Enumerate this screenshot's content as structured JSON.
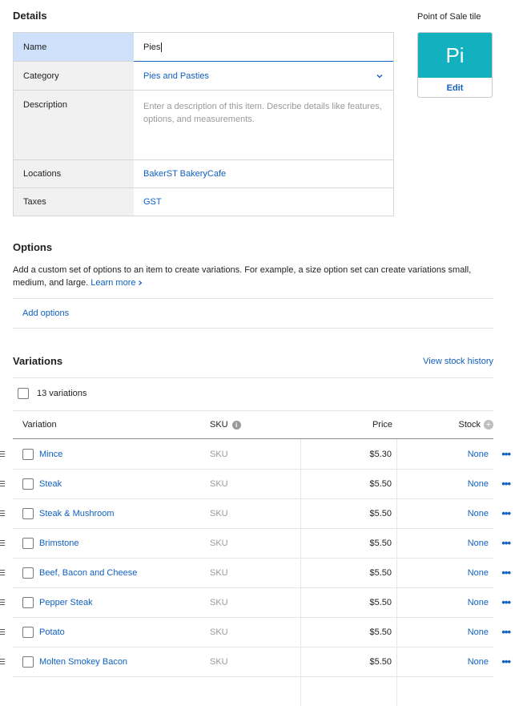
{
  "details": {
    "heading": "Details",
    "name_label": "Name",
    "name_value": "Pies",
    "category_label": "Category",
    "category_value": "Pies and Pasties",
    "description_label": "Description",
    "description_placeholder": "Enter a description of this item. Describe details like features, options, and measurements.",
    "locations_label": "Locations",
    "locations_value": "BakerST BakeryCafe",
    "taxes_label": "Taxes",
    "taxes_value": "GST"
  },
  "pos_tile": {
    "heading": "Point of Sale tile",
    "initials": "Pi",
    "edit_label": "Edit",
    "color": "#13b0bf"
  },
  "options": {
    "heading": "Options",
    "description": "Add a custom set of options to an item to create variations. For example, a size option set can create variations small, medium, and large.",
    "learn_more": "Learn more",
    "add_options": "Add options"
  },
  "variations": {
    "heading": "Variations",
    "view_stock_history": "View stock history",
    "count_label": "13 variations",
    "columns": {
      "variation": "Variation",
      "sku": "SKU",
      "price": "Price",
      "stock": "Stock"
    },
    "rows": [
      {
        "name": "Mince",
        "sku": "SKU",
        "price": "$5.30",
        "stock": "None"
      },
      {
        "name": "Steak",
        "sku": "SKU",
        "price": "$5.50",
        "stock": "None"
      },
      {
        "name": "Steak & Mushroom",
        "sku": "SKU",
        "price": "$5.50",
        "stock": "None"
      },
      {
        "name": "Brimstone",
        "sku": "SKU",
        "price": "$5.50",
        "stock": "None"
      },
      {
        "name": "Beef, Bacon and Cheese",
        "sku": "SKU",
        "price": "$5.50",
        "stock": "None"
      },
      {
        "name": "Pepper Steak",
        "sku": "SKU",
        "price": "$5.50",
        "stock": "None"
      },
      {
        "name": "Potato",
        "sku": "SKU",
        "price": "$5.50",
        "stock": "None"
      },
      {
        "name": "Molten Smokey Bacon",
        "sku": "SKU",
        "price": "$5.50",
        "stock": "None"
      }
    ]
  },
  "colors": {
    "accent": "#1060c0",
    "selected_label_bg": "#cfe0fb"
  }
}
